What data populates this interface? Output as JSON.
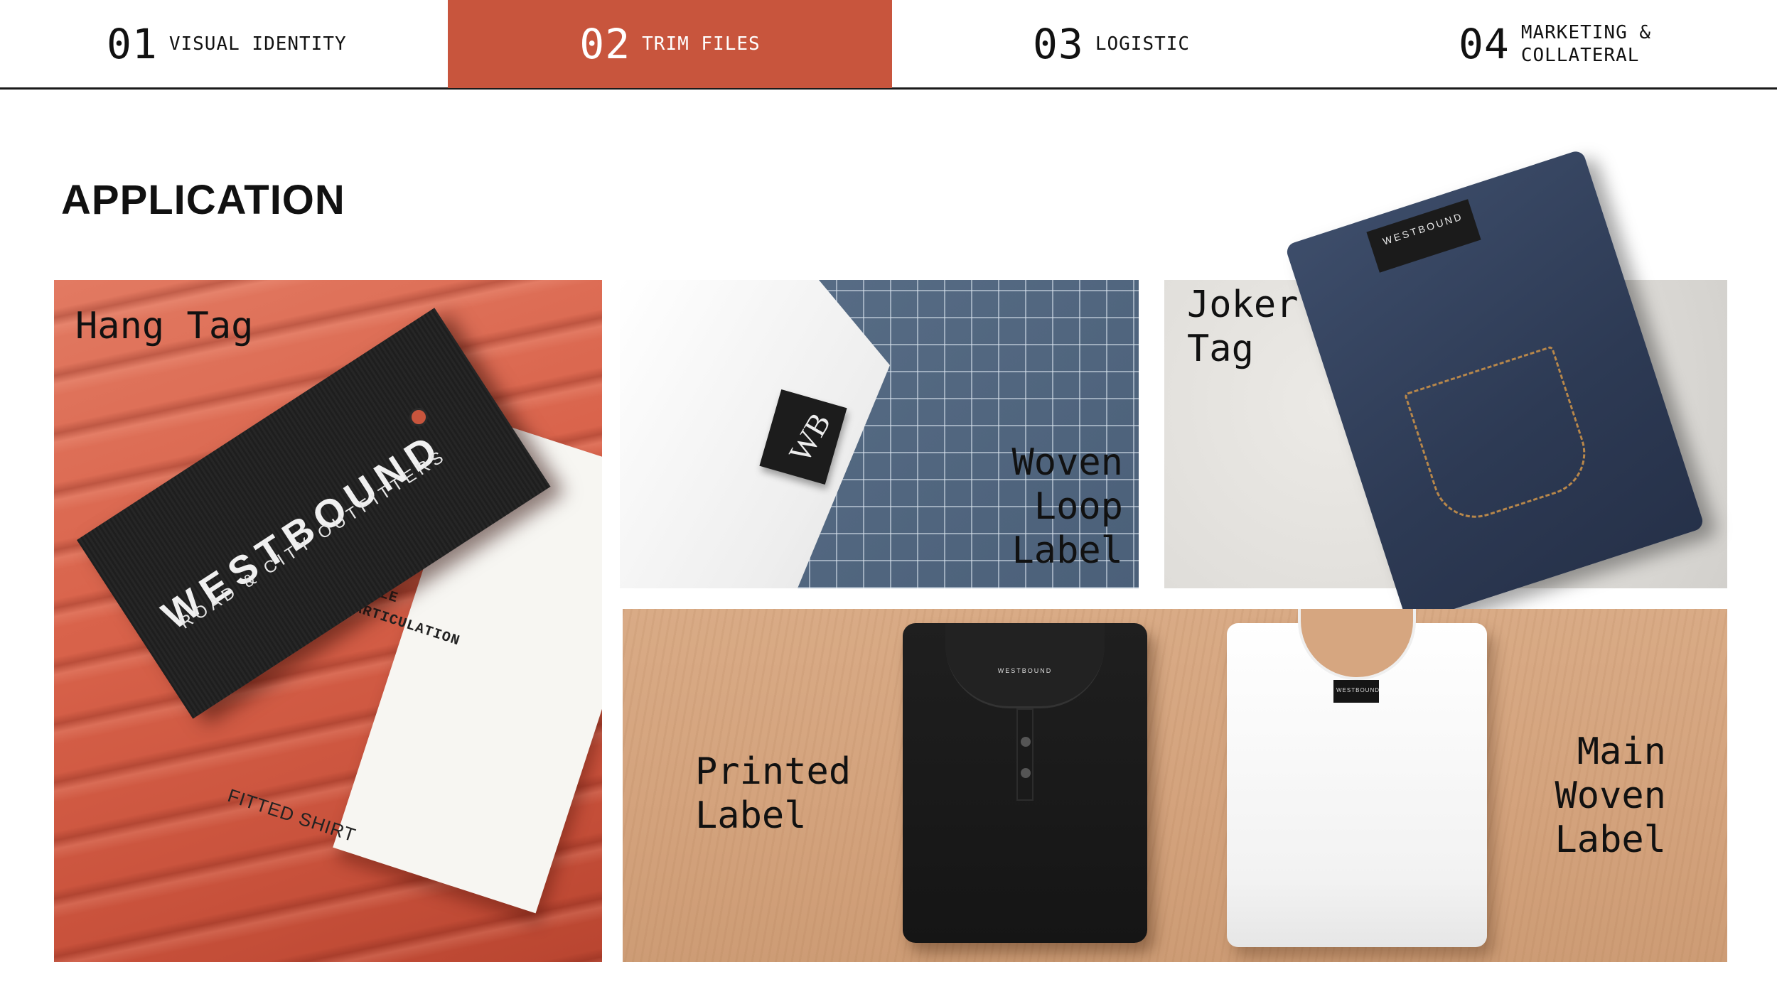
{
  "nav": {
    "tabs": [
      {
        "num": "01",
        "label": "VISUAL IDENTITY"
      },
      {
        "num": "02",
        "label": "TRIM FILES"
      },
      {
        "num": "03",
        "label": "LOGISTIC"
      },
      {
        "num": "04",
        "label": "MARKETING &\nCOLLATERAL"
      }
    ],
    "active_color": "#c8553d"
  },
  "page": {
    "heading": "APPLICATION"
  },
  "panels": {
    "hang_tag": {
      "label": "Hang Tag",
      "brand": "WESTBOUND",
      "brand_sub": "ROAD & CITY OUTFITTERS",
      "white_line1": "OFILE",
      "white_line2": "ED ARTICULATION",
      "white_bottom": "FITTED SHIRT"
    },
    "woven_loop": {
      "label": "Woven\nLoop\nLabel",
      "mark": "WB"
    },
    "joker": {
      "label": "Joker\nTag",
      "tag_text": "WESTBOUND"
    },
    "printed": {
      "label": "Printed\nLabel",
      "polo_tag": "WESTBOUND"
    },
    "main_woven": {
      "label": "Main\nWoven\nLabel",
      "tee_tag": "WESTBOUND"
    }
  }
}
